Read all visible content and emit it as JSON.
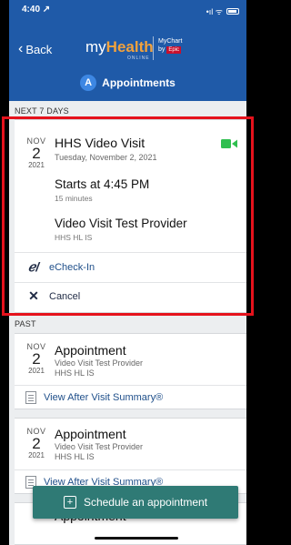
{
  "status_bar": {
    "time": "4:40 ↗",
    "signal": "•ıl ᯤ"
  },
  "header": {
    "back_label": "Back",
    "brand_my": "my",
    "brand_health": "Health",
    "brand_online": "ONLINE",
    "mychart_line1": "MyChart",
    "mychart_line2": "by",
    "mychart_epic": "Epic",
    "section_icon_letter": "A",
    "section_title": "Appointments"
  },
  "upcoming": {
    "label": "NEXT 7 DAYS",
    "card": {
      "month": "NOV",
      "day": "2",
      "year": "2021",
      "title": "HHS Video Visit",
      "date_text": "Tuesday, November 2, 2021",
      "start_text": "Starts at 4:45 PM",
      "duration": "15 minutes",
      "provider": "Video Visit Test Provider",
      "department": "HHS HL IS",
      "echeckin_label": "eCheck-In",
      "cancel_label": "Cancel"
    }
  },
  "past": {
    "label": "PAST",
    "items": [
      {
        "month": "NOV",
        "day": "2",
        "year": "2021",
        "title": "Appointment",
        "provider": "Video Visit Test Provider",
        "department": "HHS HL IS",
        "avs_label": "View After Visit Summary®"
      },
      {
        "month": "NOV",
        "day": "2",
        "year": "2021",
        "title": "Appointment",
        "provider": "Video Visit Test Provider",
        "department": "HHS HL IS",
        "avs_label": "View After Visit Summary®"
      }
    ],
    "partial_title": "Appointment"
  },
  "schedule_button_label": "Schedule an appointment",
  "colors": {
    "header": "#1f5aa8",
    "accent_orange": "#f2a23c",
    "video_green": "#2fbf4f",
    "button_teal": "#2f7a75",
    "highlight_red": "#e5121c"
  }
}
